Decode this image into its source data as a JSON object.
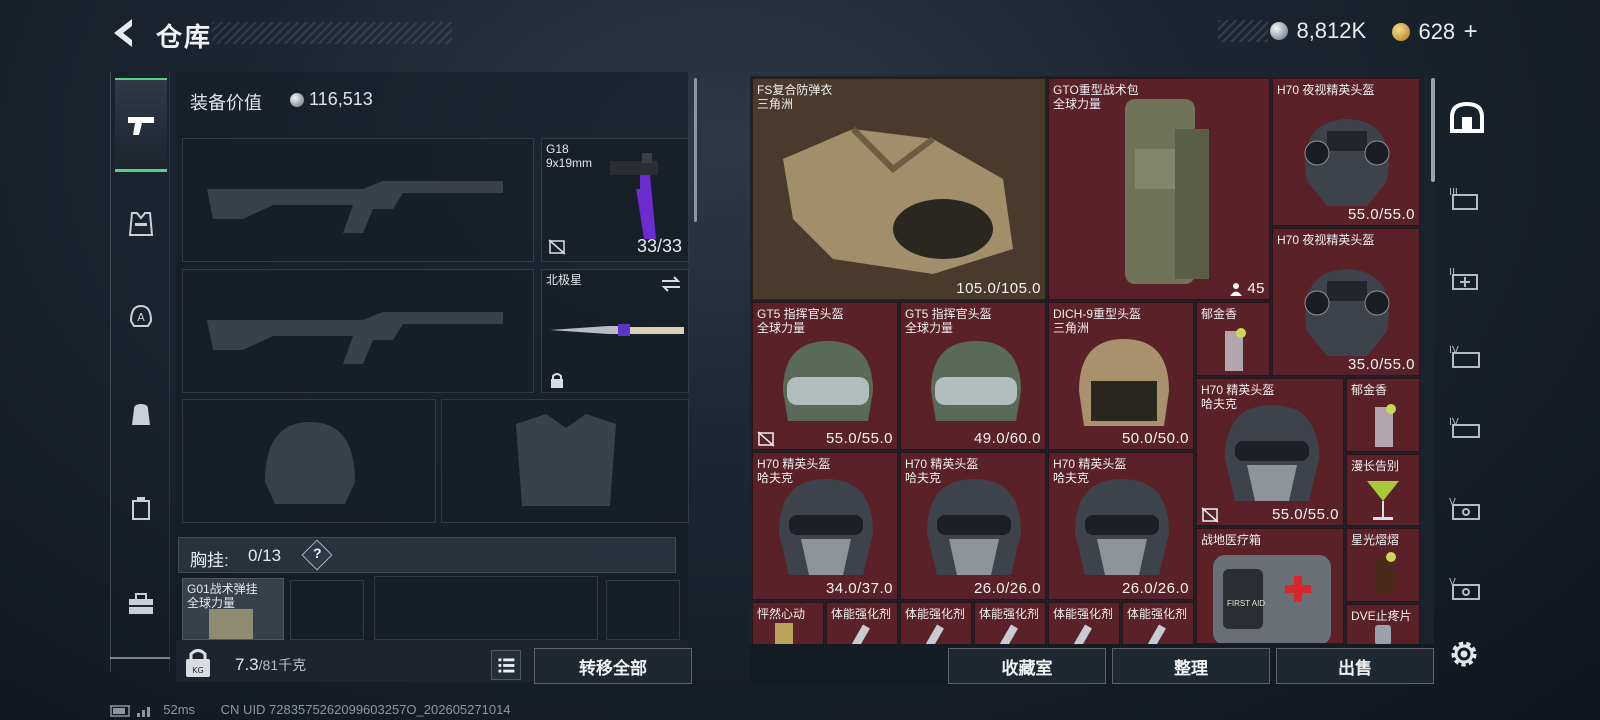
{
  "header": {
    "title": "仓库",
    "currency_silver": "8,812K",
    "currency_gold": "628",
    "add_symbol": "+"
  },
  "equipment": {
    "value_label": "装备价值",
    "value": "116,513",
    "sidearm": {
      "name": "G18",
      "caliber": "9x19mm",
      "ammo": "33/33"
    },
    "melee": {
      "name": "北极星"
    },
    "chest_rig": {
      "label": "胸挂:",
      "capacity": "0/13",
      "help": "?",
      "item_name": "G01战术弹挂",
      "item_source": "全球力量"
    },
    "weight": "7.3",
    "weight_max": "/81千克",
    "transfer_all": "转移全部"
  },
  "storage_items": [
    {
      "name": "FS复合防弹衣",
      "sub": "三角洲",
      "dur": "105.0/105.0"
    },
    {
      "name": "GTO重型战术包",
      "sub": "全球力量",
      "dur": "45"
    },
    {
      "name": "H70 夜视精英头盔",
      "sub": "",
      "dur": "55.0/55.0"
    },
    {
      "name": "H70 夜视精英头盔",
      "sub": "",
      "dur": "35.0/55.0"
    },
    {
      "name": "GT5 指挥官头盔",
      "sub": "全球力量",
      "dur": "55.0/55.0"
    },
    {
      "name": "GT5 指挥官头盔",
      "sub": "全球力量",
      "dur": "49.0/60.0"
    },
    {
      "name": "DICH-9重型头盔",
      "sub": "三角洲",
      "dur": "50.0/50.0"
    },
    {
      "name": "郁金香",
      "sub": "",
      "dur": ""
    },
    {
      "name": "H70 精英头盔",
      "sub": "哈夫克",
      "dur": "55.0/55.0"
    },
    {
      "name": "郁金香",
      "sub": "",
      "dur": ""
    },
    {
      "name": "漫长告别",
      "sub": "",
      "dur": ""
    },
    {
      "name": "H70 精英头盔",
      "sub": "哈夫克",
      "dur": "34.0/37.0"
    },
    {
      "name": "H70 精英头盔",
      "sub": "哈夫克",
      "dur": "26.0/26.0"
    },
    {
      "name": "H70 精英头盔",
      "sub": "哈夫克",
      "dur": "26.0/26.0"
    },
    {
      "name": "战地医疗箱",
      "sub": "",
      "dur": ""
    },
    {
      "name": "星光熠熠",
      "sub": "",
      "dur": ""
    },
    {
      "name": "怦然心动",
      "sub": "",
      "dur": ""
    },
    {
      "name": "体能强化剂",
      "sub": "",
      "dur": ""
    },
    {
      "name": "体能强化剂",
      "sub": "",
      "dur": ""
    },
    {
      "name": "体能强化剂",
      "sub": "",
      "dur": ""
    },
    {
      "name": "体能强化剂",
      "sub": "",
      "dur": ""
    },
    {
      "name": "DVE止疼片",
      "sub": "",
      "dur": ""
    }
  ],
  "first_aid_label": "FIRST AID",
  "right_tabs": [
    "III",
    "II",
    "IV",
    "IV",
    "V",
    "V"
  ],
  "actions": {
    "collection": "收藏室",
    "organize": "整理",
    "sell": "出售"
  },
  "status": {
    "ping": "52ms",
    "uid": "CN UID 7283575262099603257O_202605271014"
  },
  "colors": {
    "accent_green": "#58d08a",
    "item_red": "#5a2128",
    "item_tan": "#4a3a2c"
  }
}
